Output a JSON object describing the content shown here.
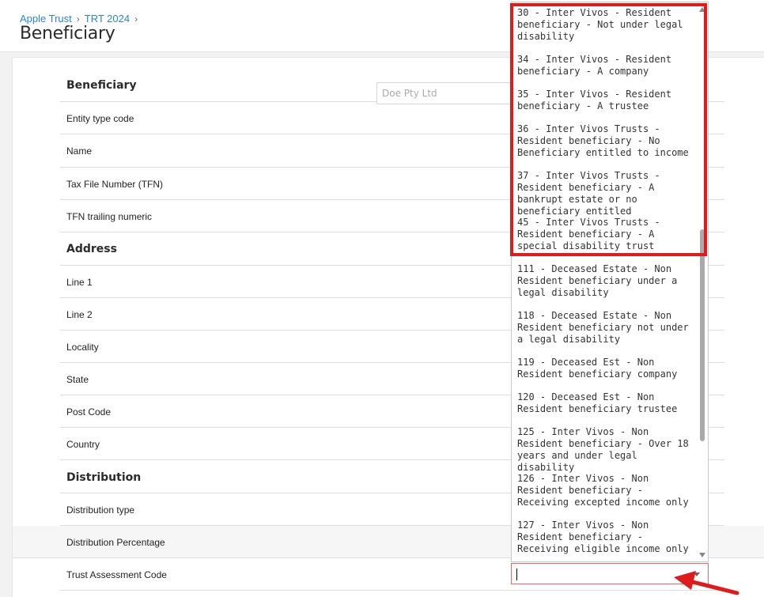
{
  "breadcrumb": [
    "Apple Trust",
    "TRT 2024"
  ],
  "page_title": "Beneficiary",
  "sections": {
    "beneficiary": "Beneficiary",
    "address": "Address",
    "distribution": "Distribution"
  },
  "fields": {
    "entity_type_code": "Entity type code",
    "name": "Name",
    "name_placeholder": "Doe Pty Ltd",
    "tfn": "Tax File Number (TFN)",
    "tfn_trailing": "TFN trailing numeric",
    "line1": "Line 1",
    "line2": "Line 2",
    "locality": "Locality",
    "state": "State",
    "post_code": "Post Code",
    "country": "Country",
    "distribution_type": "Distribution type",
    "distribution_percentage": "Distribution Percentage",
    "trust_assessment_code": "Trust Assessment Code"
  },
  "dropdown_options": [
    "30 - Inter Vivos - Resident beneficiary - Not under legal disability",
    "34 - Inter Vivos - Resident beneficiary - A company",
    "35 - Inter Vivos - Resident beneficiary - A trustee",
    "36 - Inter Vivos Trusts - Resident beneficiary - No Beneficiary entitled to income",
    "37 - Inter Vivos Trusts - Resident beneficiary - A bankrupt estate or no beneficiary entitled",
    "45 - Inter Vivos Trusts - Resident beneficiary - A special disability trust",
    "111 - Deceased Estate - Non Resident beneficiary under a legal disability",
    "118 - Deceased Estate - Non Resident beneficiary not under a legal disability",
    "119 - Deceased Est - Non Resident beneficiary company",
    "120 - Deceased Est - Non Resident beneficiary trustee",
    "125 - Inter Vivos - Non Resident beneficiary - Over 18 years and under legal disability",
    "126 - Inter Vivos - Non Resident beneficiary - Receiving excepted income only",
    "127 - Inter Vivos - Non Resident beneficiary - Receiving eligible income only"
  ],
  "colors": {
    "highlight": "#e01b1b",
    "link": "#2a86d1"
  }
}
